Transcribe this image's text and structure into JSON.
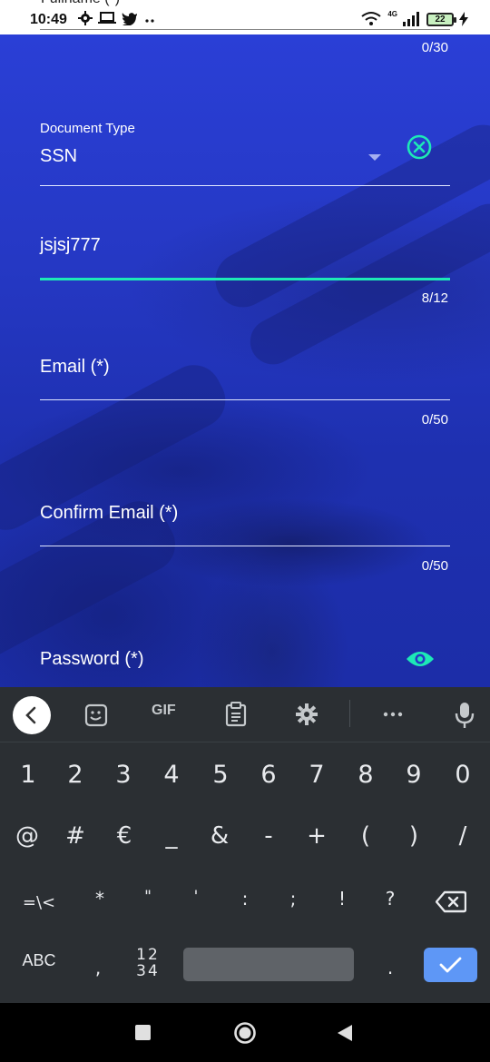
{
  "status_bar": {
    "time": "10:49",
    "network": "4G",
    "battery": "22",
    "partial_title": "Fullname (*)"
  },
  "form": {
    "fullname_counter": "0/30",
    "document_type": {
      "label": "Document Type",
      "value": "SSN"
    },
    "document_number": {
      "value": "jsjsj777",
      "counter": "8/12"
    },
    "email": {
      "placeholder": "Email (*)",
      "counter": "0/50"
    },
    "confirm_email": {
      "placeholder": "Confirm Email (*)",
      "counter": "0/50"
    },
    "password": {
      "placeholder": "Password (*)"
    },
    "colors": {
      "accent": "#1de9b6",
      "background": "#2538c4"
    }
  },
  "keyboard": {
    "toolbar": {
      "gif": "GIF"
    },
    "row1": [
      "1",
      "2",
      "3",
      "4",
      "5",
      "6",
      "7",
      "8",
      "9",
      "0"
    ],
    "row2": [
      "@",
      "#",
      "€",
      "_",
      "&",
      "-",
      "+",
      "(",
      ")",
      "/"
    ],
    "row3": [
      "=\\<",
      "*",
      "\"",
      "'",
      ":",
      ";",
      "!",
      "?"
    ],
    "row4": {
      "abc": "ABC",
      "comma": ",",
      "numpad_top": "12",
      "numpad_bottom": "34",
      "period": "."
    },
    "colors": {
      "background": "#2b2f33",
      "enter": "#5e97f6"
    }
  }
}
